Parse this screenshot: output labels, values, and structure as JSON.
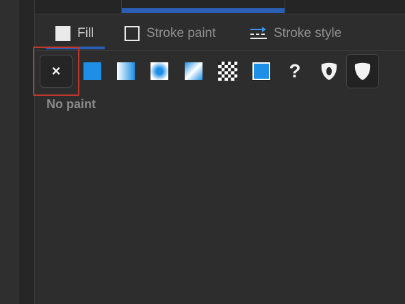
{
  "tabs": [
    {
      "label": "Fill",
      "icon": "fill-square-icon",
      "active": true
    },
    {
      "label": "Stroke paint",
      "icon": "stroke-square-icon",
      "active": false
    },
    {
      "label": "Stroke style",
      "icon": "stroke-style-icon",
      "active": false
    }
  ],
  "paint_types": [
    {
      "id": "none",
      "icon": "x-icon",
      "glyph": "×",
      "selected": true
    },
    {
      "id": "flat",
      "icon": "flat-color-icon"
    },
    {
      "id": "linear",
      "icon": "linear-gradient-icon"
    },
    {
      "id": "radial",
      "icon": "radial-gradient-icon"
    },
    {
      "id": "mesh",
      "icon": "mesh-gradient-icon"
    },
    {
      "id": "pattern",
      "icon": "pattern-icon"
    },
    {
      "id": "swatch",
      "icon": "swatch-icon"
    },
    {
      "id": "unset",
      "icon": "question-icon",
      "glyph": "?"
    }
  ],
  "fill_rules": [
    {
      "id": "evenodd",
      "icon": "fill-rule-evenodd-icon",
      "selected": false
    },
    {
      "id": "nonzero",
      "icon": "fill-rule-nonzero-icon",
      "selected": true
    }
  ],
  "current_paint_label": "No paint",
  "colors": {
    "accent": "#2a5fb5",
    "paint_blue": "#1d8fe6",
    "highlight": "#c0382b"
  }
}
